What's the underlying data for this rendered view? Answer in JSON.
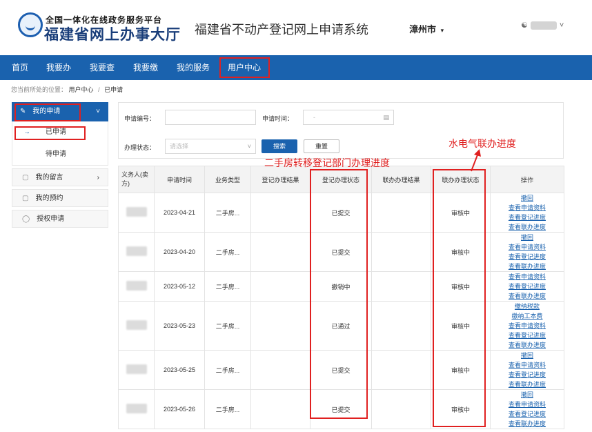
{
  "header": {
    "logo_line1": "全国一体化在线政务服务平台",
    "logo_line2": "福建省网上办事大厅",
    "system_title": "福建省不动产登记网上申请系统",
    "city": "漳州市",
    "user_caret": "˅"
  },
  "nav": [
    "首页",
    "我要办",
    "我要查",
    "我要缴",
    "我的服务",
    "用户中心"
  ],
  "breadcrumb": {
    "prefix": "您当前所处的位置：",
    "level1": "用户中心",
    "sep": "/",
    "current": "已申请"
  },
  "sidebar": {
    "my_applications": "我的申请",
    "submitted": "已申请",
    "pending": "待申请",
    "messages": "我的留言",
    "appointments": "我的预约",
    "authorization": "授权申请"
  },
  "filter": {
    "app_no_label": "申请编号：",
    "app_time_label": "申请时间：",
    "app_time_placeholder": "-",
    "status_label": "办理状态：",
    "status_placeholder": "请选择",
    "search": "搜索",
    "reset": "重置"
  },
  "table": {
    "headers": [
      "义务人(卖方)",
      "申请时间",
      "业务类型",
      "登记办理结果",
      "登记办理状态",
      "联办办理结果",
      "联办办理状态",
      "操作"
    ],
    "rows": [
      {
        "date": "2023-04-21",
        "type": "二手房...",
        "reg_status": "已提交",
        "joint_status": "审核中",
        "ops": [
          "撤回",
          "查看申请资料",
          "查看登记进度",
          "查看联办进度"
        ]
      },
      {
        "date": "2023-04-20",
        "type": "二手房...",
        "reg_status": "已提交",
        "joint_status": "审核中",
        "ops": [
          "撤回",
          "查看申请资料",
          "查看登记进度",
          "查看联办进度"
        ]
      },
      {
        "date": "2023-05-12",
        "type": "二手房...",
        "reg_status": "撤销中",
        "joint_status": "审核中",
        "ops": [
          "查看申请资料",
          "查看登记进度",
          "查看联办进度"
        ]
      },
      {
        "date": "2023-05-23",
        "type": "二手房...",
        "reg_status": "已通过",
        "joint_status": "审核中",
        "ops": [
          "缴纳税款",
          "缴纳工本费",
          "查看申请资料",
          "查看登记进度",
          "查看联办进度"
        ]
      },
      {
        "date": "2023-05-25",
        "type": "二手房...",
        "reg_status": "已提交",
        "joint_status": "审核中",
        "ops": [
          "撤回",
          "查看申请资料",
          "查看登记进度",
          "查看联办进度"
        ]
      },
      {
        "date": "2023-05-26",
        "type": "二手房...",
        "reg_status": "已提交",
        "joint_status": "审核中",
        "ops": [
          "撤回",
          "查看申请资料",
          "查看登记进度",
          "查看联办进度"
        ]
      }
    ]
  },
  "annotations": {
    "reg_progress": "二手房转移登记部门办理进度",
    "joint_progress": "水电气联办进度"
  },
  "colors": {
    "brand_blue": "#1a62ae",
    "annotation_red": "#e02020"
  }
}
